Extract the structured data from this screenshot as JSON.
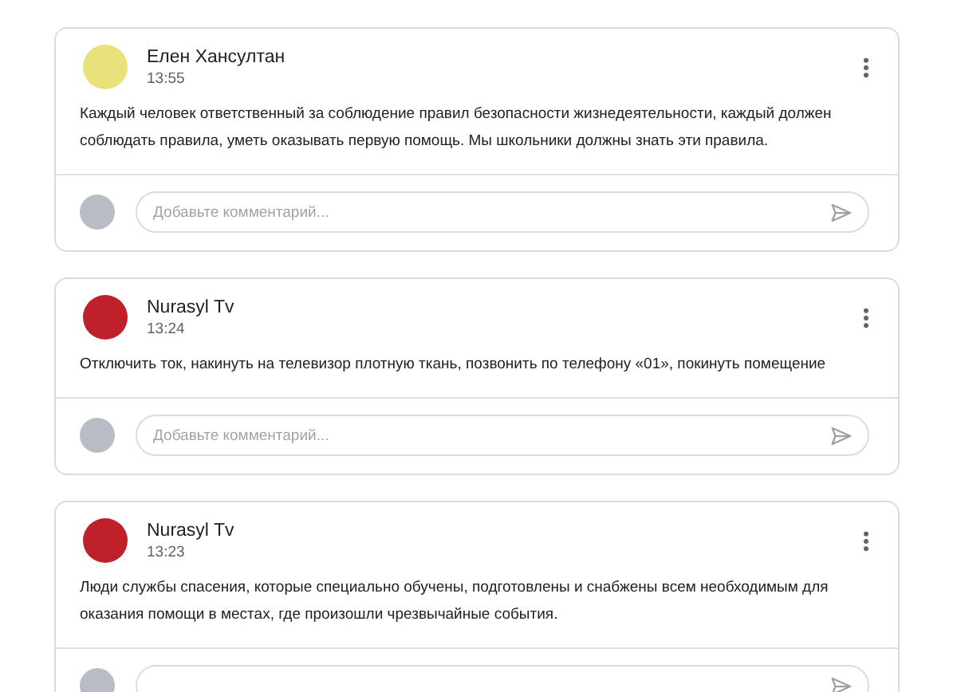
{
  "posts": [
    {
      "author": "Елен Хансултан",
      "time": "13:55",
      "text": "Каждый человек ответственный за соблюдение правил безопасности жизнедеятельности, каждый должен соблюдать правила, уметь оказывать первую помощь. Мы школьники должны знать эти правила.",
      "avatar": {
        "color": "#e9e27a"
      },
      "comment": {
        "placeholder": "Добавьте комментарий..."
      }
    },
    {
      "author": "Nurasyl Tv",
      "time": "13:24",
      "text": "Отключить ток, накинуть на телевизор плотную ткань,  позвонить по телефону «01», покинуть помещение",
      "avatar": {
        "color": "#c0202a"
      },
      "comment": {
        "placeholder": "Добавьте комментарий..."
      }
    },
    {
      "author": "Nurasyl Tv",
      "time": "13:23",
      "text": "Люди службы спасения, которые специально обучены, подготовлены и снабжены всем необходимым для оказания помощи в местах, где произошли чрезвычайные события.",
      "avatar": {
        "color": "#c0202a"
      }
    }
  ]
}
